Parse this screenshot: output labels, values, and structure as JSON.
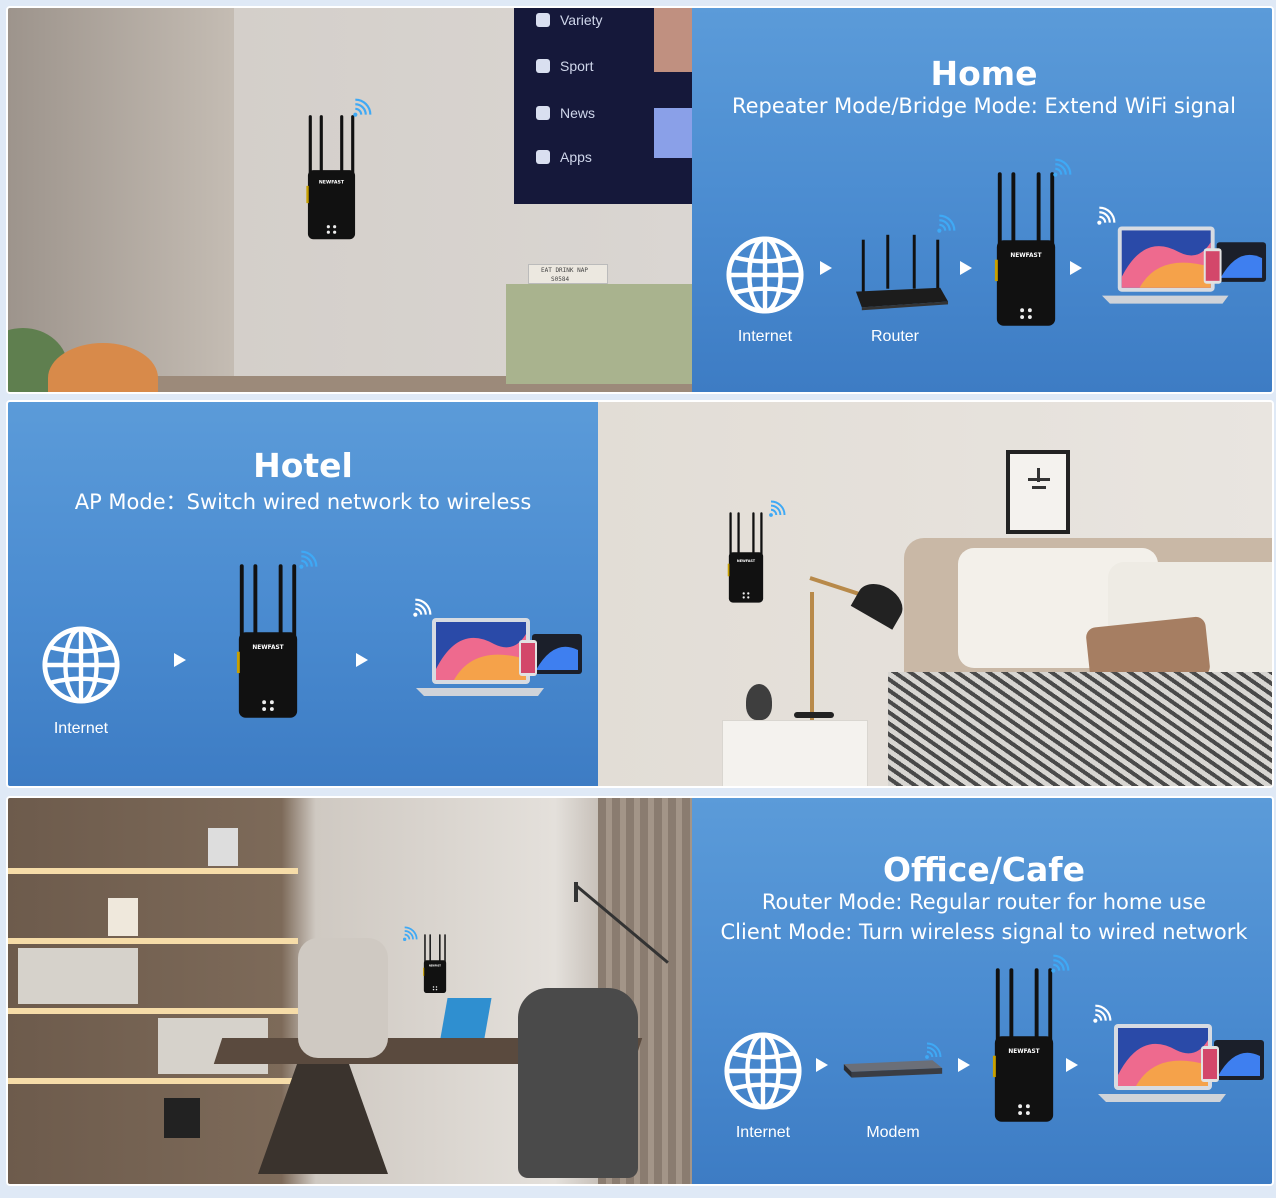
{
  "sections": {
    "home": {
      "title": "Home",
      "subtitle": "Repeater Mode/Bridge Mode: Extend WiFi signal",
      "flow": [
        {
          "label": "Internet",
          "icon": "globe-icon"
        },
        {
          "label": "Router",
          "icon": "router-icon"
        },
        {
          "label": "",
          "icon": "wifi-extender-icon"
        },
        {
          "label": "",
          "icon": "laptop-phone-icon"
        }
      ],
      "tv_menu": [
        "Variety",
        "Sport",
        "News",
        "Apps"
      ],
      "book_text": [
        "EAT DRINK NAP",
        "S0584"
      ]
    },
    "hotel": {
      "title": "Hotel",
      "subtitle": "AP Mode：Switch wired network to wireless",
      "flow": [
        {
          "label": "Internet",
          "icon": "globe-icon"
        },
        {
          "label": "",
          "icon": "wifi-extender-icon"
        },
        {
          "label": "",
          "icon": "laptop-phone-icon"
        }
      ]
    },
    "office": {
      "title": "Office/Cafe",
      "line1": "Router Mode: Regular router for home use",
      "line2": "Client Mode: Turn wireless signal to wired network",
      "flow": [
        {
          "label": "Internet",
          "icon": "globe-icon"
        },
        {
          "label": "Modem",
          "icon": "modem-icon"
        },
        {
          "label": "",
          "icon": "wifi-extender-icon"
        },
        {
          "label": "",
          "icon": "laptop-phone-icon"
        }
      ]
    }
  },
  "device_brand": "NEWFAST",
  "colors": {
    "panel_blue": "#4a8bd0",
    "wifi_signal": "#3fa9f5",
    "device": "#111111"
  }
}
